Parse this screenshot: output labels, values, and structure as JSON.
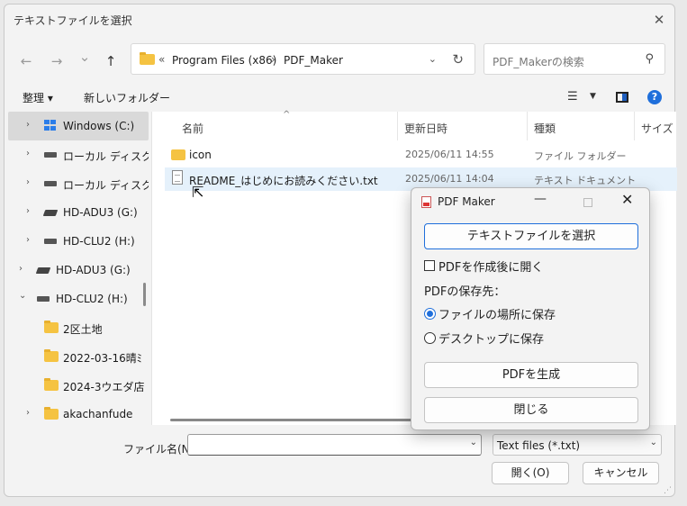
{
  "dialog": {
    "title": "テキストファイルを選択",
    "close_glyph": "✕"
  },
  "nav": {
    "back_glyph": "←",
    "forward_glyph": "→",
    "recent_glyph": "⌄",
    "up_glyph": "↑"
  },
  "address": {
    "overflow": "«",
    "parts": [
      "Program Files (x86)",
      "PDF_Maker"
    ],
    "separator": "›",
    "dropdown_glyph": "⌄",
    "refresh_glyph": "↻"
  },
  "search": {
    "placeholder": "PDF_Makerの検索",
    "icon_glyph": "⚲"
  },
  "toolbar": {
    "organize_label": "整理 ▾",
    "new_folder_label": "新しいフォルダー",
    "view_glyph": "☰",
    "view_drop_glyph": "▼",
    "help_glyph": "?"
  },
  "sidebar": {
    "items": [
      {
        "label": "Windows (C:)",
        "icon": "windows-drive-icon",
        "expand": "›"
      },
      {
        "label": "ローカル ディスク",
        "icon": "drive-icon",
        "expand": "›"
      },
      {
        "label": "ローカル ディスク",
        "icon": "drive-icon",
        "expand": "›"
      },
      {
        "label": "HD-ADU3 (G:)",
        "icon": "external-drive-icon",
        "expand": "›"
      },
      {
        "label": "HD-CLU2 (H:)",
        "icon": "drive-icon",
        "expand": "›"
      },
      {
        "label": "HD-ADU3 (G:)",
        "icon": "external-drive-icon",
        "expand": "›"
      },
      {
        "label": "HD-CLU2 (H:)",
        "icon": "drive-icon",
        "expand": "⌄"
      },
      {
        "label": "2区土地",
        "icon": "folder-icon",
        "expand": ""
      },
      {
        "label": "2022-03-16晴ﾐ",
        "icon": "folder-icon",
        "expand": ""
      },
      {
        "label": "2024-3ウエダ店",
        "icon": "folder-icon",
        "expand": ""
      },
      {
        "label": "akachanfude",
        "icon": "folder-icon",
        "expand": "›"
      }
    ]
  },
  "files": {
    "columns": [
      "名前",
      "更新日時",
      "種類",
      "サイズ"
    ],
    "sort_glyph": "^",
    "rows": [
      {
        "name": "icon",
        "date": "2025/06/11 14:55",
        "type": "ファイル フォルダー",
        "icon": "folder-icon"
      },
      {
        "name": "README_はじめにお読みください.txt",
        "date": "2025/06/11 14:04",
        "type": "テキスト ドキュメント",
        "icon": "text-file-icon"
      }
    ],
    "cursor_glyph": "⇱"
  },
  "footer": {
    "filename_label": "ファイル名(N):",
    "filename_value": "",
    "filetype_value": "Text files (*.txt)",
    "drop_glyph": "⌄",
    "open_label": "開く(O)",
    "cancel_label": "キャンセル",
    "grip_glyph": "⋰"
  },
  "popup": {
    "title": "PDF Maker",
    "min_glyph": "—",
    "close_glyph": "✕",
    "select_button": "テキストファイルを選択",
    "open_after_label": "PDFを作成後に開く",
    "open_after_checked": false,
    "save_dest_label": "PDFの保存先：",
    "radio_same_label": "ファイルの場所に保存",
    "radio_desktop_label": "デスクトップに保存",
    "selected_radio": "same",
    "generate_button": "PDFを生成",
    "close_button": "閉じる"
  }
}
